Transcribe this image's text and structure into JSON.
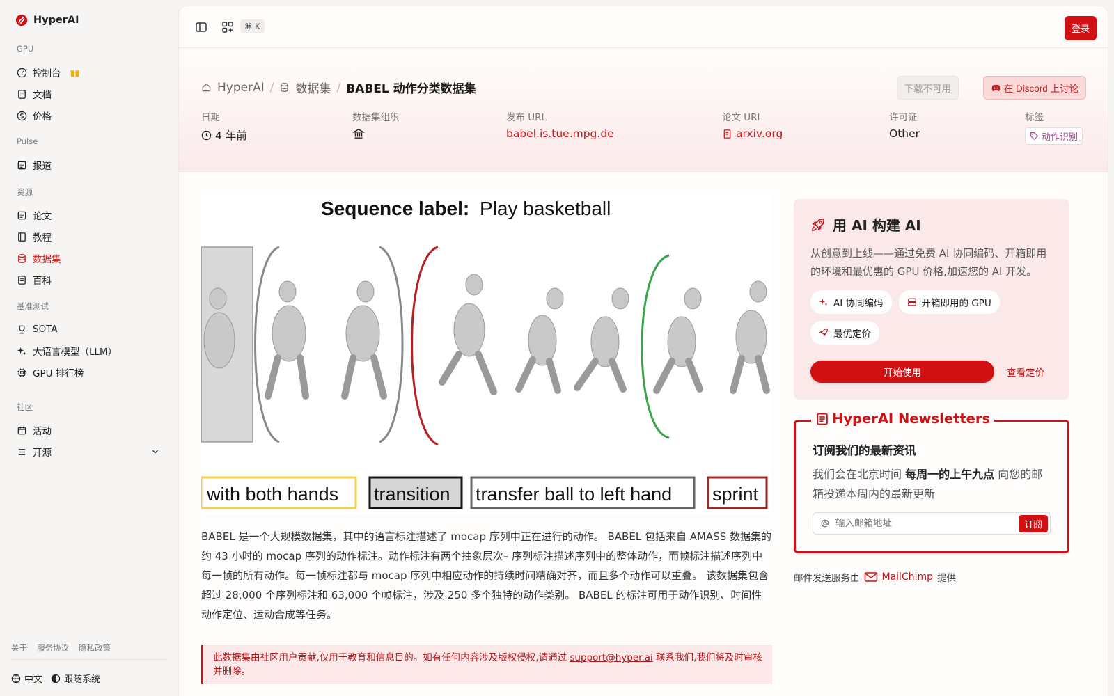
{
  "brand": {
    "name": "HyperAI"
  },
  "sidebar": {
    "sections": [
      "GPU",
      "Pulse",
      "资源",
      "基准测试",
      "社区"
    ],
    "items": [
      {
        "label": "控制台"
      },
      {
        "label": "文档"
      },
      {
        "label": "价格"
      },
      {
        "label": "报道"
      },
      {
        "label": "论文"
      },
      {
        "label": "教程"
      },
      {
        "label": "数据集"
      },
      {
        "label": "百科"
      },
      {
        "label": "SOTA"
      },
      {
        "label": "大语言模型（LLM）"
      },
      {
        "label": "GPU 排行榜"
      },
      {
        "label": "活动"
      },
      {
        "label": "开源"
      }
    ],
    "footer_links": [
      "关于",
      "服务协议",
      "隐私政策"
    ],
    "language": "中文",
    "theme": "跟随系统"
  },
  "topbar": {
    "shortcut": "⌘ K",
    "login": "登录"
  },
  "header": {
    "crumbs": [
      "HyperAI",
      "数据集",
      "BABEL 动作分类数据集"
    ],
    "download_btn": "下载不可用",
    "discord_btn": "在 Discord 上讨论",
    "meta": {
      "date_label": "日期",
      "date_value": "4 年前",
      "org_label": "数据集组织",
      "url_label": "发布 URL",
      "url_value": "babel.is.tue.mpg.de",
      "paper_label": "论文 URL",
      "paper_value": "arxiv.org",
      "license_label": "许可证",
      "license_value": "Other",
      "tags_label": "标签",
      "tag_value": "动作识别"
    }
  },
  "figure": {
    "sequence_prefix": "Sequence label:",
    "sequence_value": "Play basketball",
    "frame_labels": [
      "with both hands",
      "transition",
      "transfer ball to left hand",
      "sprint"
    ]
  },
  "description": "BABEL 是一个大规模数据集，其中的语言标注描述了 mocap 序列中正在进行的动作。 BABEL 包括来自 AMASS 数据集的约 43 小时的 mocap 序列的动作标注。动作标注有两个抽象层次– 序列标注描述序列中的整体动作，而帧标注描述序列中每一帧的所有动作。每一帧标注都与 mocap 序列中相应动作的持续时间精确对齐，而且多个动作可以重叠。 该数据集包含超过 28,000 个序列标注和 63,000 个帧标注，涉及 250 多个独特的动作类别。 BABEL 的标注可用于动作识别、时间性动作定位、运动合成等任务。",
  "notice": {
    "text_before": "此数据集由社区用户贡献,仅用于教育和信息目的。如有任何内容涉及版权侵权,请通过 ",
    "email": "support@hyper.ai",
    "text_after": " 联系我们,我们将及时审核并删除。"
  },
  "ai_card": {
    "title": "用 AI 构建 AI",
    "subtitle": "从创意到上线——通过免费 AI 协同编码、开箱即用的环境和最优惠的 GPU 价格,加速您的 AI 开发。",
    "chips": [
      "AI 协同编码",
      "开箱即用的 GPU",
      "最优定价"
    ],
    "cta": "开始使用",
    "pricing_link": "查看定价"
  },
  "newsletter": {
    "title": "HyperAI Newsletters",
    "heading": "订阅我们的最新资讯",
    "sub_before": "我们会在北京时间 ",
    "sub_bold": "每周一的上午九点",
    "sub_after": " 向您的邮箱投递本周内的最新更新",
    "placeholder": "输入邮箱地址",
    "button": "订阅"
  },
  "mail_provider": {
    "prefix": "邮件发送服务由",
    "name": "MailChimp",
    "suffix": "提供"
  },
  "colors": {
    "accent": "#d11014",
    "link": "#c81318",
    "sidebar_bg": "#f6f5f4"
  }
}
